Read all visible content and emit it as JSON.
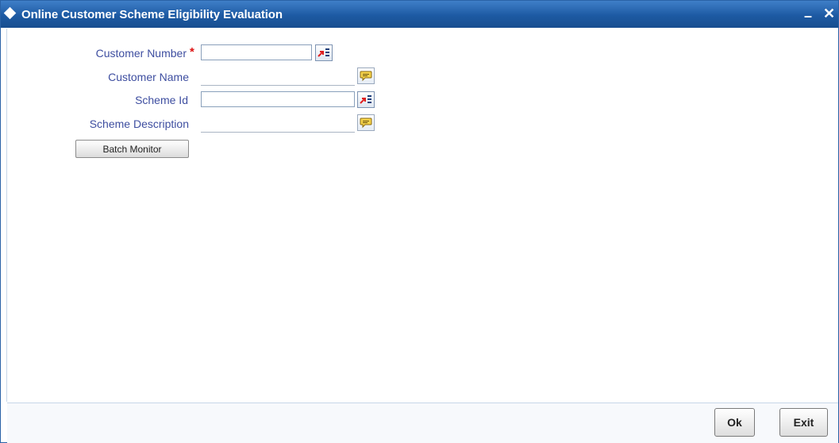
{
  "window": {
    "title": "Online Customer Scheme Eligibility Evaluation",
    "minimize_glyph": "–",
    "close_glyph": "✕"
  },
  "form": {
    "customer_number": {
      "label": "Customer Number",
      "required_mark": "*",
      "value": ""
    },
    "customer_name": {
      "label": "Customer Name",
      "value": ""
    },
    "scheme_id": {
      "label": "Scheme Id",
      "value": ""
    },
    "scheme_description": {
      "label": "Scheme Description",
      "value": ""
    },
    "batch_monitor_label": "Batch Monitor"
  },
  "footer": {
    "ok_label": "Ok",
    "exit_label": "Exit"
  },
  "icons": {
    "lov": "list-of-values-icon",
    "popup": "speech-bubble-icon",
    "title": "diamond-icon"
  },
  "colors": {
    "titlebar": "#1d5aa3",
    "label_text": "#3e4ea0",
    "required": "#dd1111"
  }
}
